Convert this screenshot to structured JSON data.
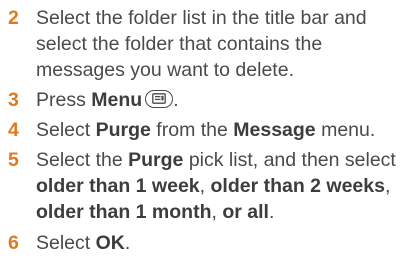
{
  "steps": [
    {
      "number": "2",
      "text": "Select the folder list in the title bar and select the folder that contains the messages you want to delete."
    },
    {
      "number": "3",
      "prefix": "Press ",
      "bold": "Menu",
      "icon": "menu-key-icon",
      "suffix": "."
    },
    {
      "number": "4",
      "prefix": "Select ",
      "bold1": "Purge",
      "middle": " from the ",
      "bold2": "Message",
      "suffix": " menu."
    },
    {
      "number": "5",
      "prefix": "Select the ",
      "bold1": "Purge",
      "middle": " pick list, and then select ",
      "opt1": "older than 1 week",
      "sep1": ", ",
      "opt2": "older than 2 weeks",
      "sep2": ", ",
      "opt3": "older than 1 month",
      "sep3": ", ",
      "opt4": "or all",
      "suffix": "."
    },
    {
      "number": "6",
      "prefix": "Select ",
      "bold": "OK",
      "suffix": "."
    }
  ],
  "colors": {
    "step_number": "#e07a22",
    "body_text": "#4a4a4a"
  }
}
